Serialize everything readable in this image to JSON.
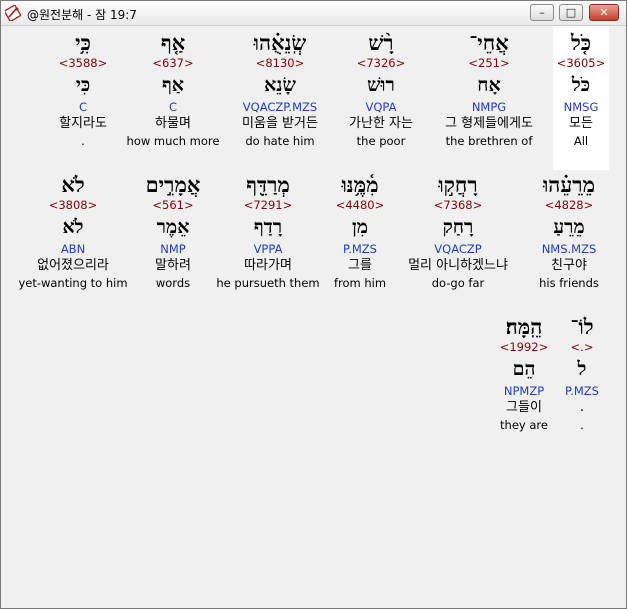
{
  "window": {
    "title": "@원전분해 - 잠 19:7"
  },
  "controls": {
    "minimize": "–",
    "maximize": "□",
    "close": "✕"
  },
  "icons": {
    "app": "bible-app-icon"
  },
  "rows": [
    [
      {
        "hebrew": "כֹּ֤ל",
        "strong": "<3605>",
        "lemma": "כֹּל",
        "morph": "NMSG",
        "korean": "모든",
        "english": "All",
        "highlight": true
      },
      {
        "hebrew": "אֲחֵי־",
        "strong": "<251>",
        "lemma": "אָח",
        "morph": "NMPG",
        "korean": "그 형제들에게도",
        "english": "the brethren of"
      },
      {
        "hebrew": "רָ֨שׁ",
        "strong": "<7326>",
        "lemma": "רוּשׁ",
        "morph": "VQPA",
        "korean": "가난한 자는",
        "english": "the poor"
      },
      {
        "hebrew": "שְֽׂנֵאֻ֗הוּ",
        "strong": "<8130>",
        "lemma": "שָׂנֵא",
        "morph": "VQACZP.MZS",
        "korean": "미움을 받거든",
        "english": "do hate him"
      },
      {
        "hebrew": "אַ֤ף",
        "strong": "<637>",
        "lemma": "אַף",
        "morph": "C",
        "korean": "하물며",
        "english": "how much more"
      },
      {
        "hebrew": "כִּ֥י",
        "strong": "<3588>",
        "lemma": "כִּי",
        "morph": "C",
        "korean": "할지라도",
        "english": "."
      }
    ],
    [
      {
        "hebrew": "מֵרֵעֵ֗הוּ",
        "strong": "<4828>",
        "lemma": "מֵרֵעַ",
        "morph": "NMS.MZS",
        "korean": "친구야",
        "english": "his friends"
      },
      {
        "hebrew": "רָחֲק֣וּ",
        "strong": "<7368>",
        "lemma": "רָחַק",
        "morph": "VQACZP",
        "korean": "멀리 아니하겠느냐",
        "english": "do-go far"
      },
      {
        "hebrew": "מִ֫מֶּ֥נּוּ",
        "strong": "<4480>",
        "lemma": "מִן",
        "morph": "P.MZS",
        "korean": "그를",
        "english": "from him"
      },
      {
        "hebrew": "מְרַדֵּ֖ף",
        "strong": "<7291>",
        "lemma": "רָדַף",
        "morph": "VPPA",
        "korean": "따라가며",
        "english": "he pursueth them"
      },
      {
        "hebrew": "אֲמָרִ֣ים",
        "strong": "<561>",
        "lemma": "אֵמֶר",
        "morph": "NMP",
        "korean": "말하려",
        "english": "words"
      },
      {
        "hebrew": "לֹא",
        "strong": "<3808>",
        "lemma": "לֹא",
        "morph": "ABN",
        "korean": "없어졌으리라",
        "english": "yet-wanting to him"
      }
    ],
    [
      {
        "hebrew": "לוֹ־",
        "strong": "<.>",
        "lemma": "ל",
        "morph": "P.MZS",
        "korean": ".",
        "english": "."
      },
      {
        "hebrew": "הֵֽמָּה׃",
        "strong": "<1992>",
        "lemma": "הֵם",
        "morph": "NPMZP",
        "korean": "그들이",
        "english": "they are"
      }
    ]
  ]
}
